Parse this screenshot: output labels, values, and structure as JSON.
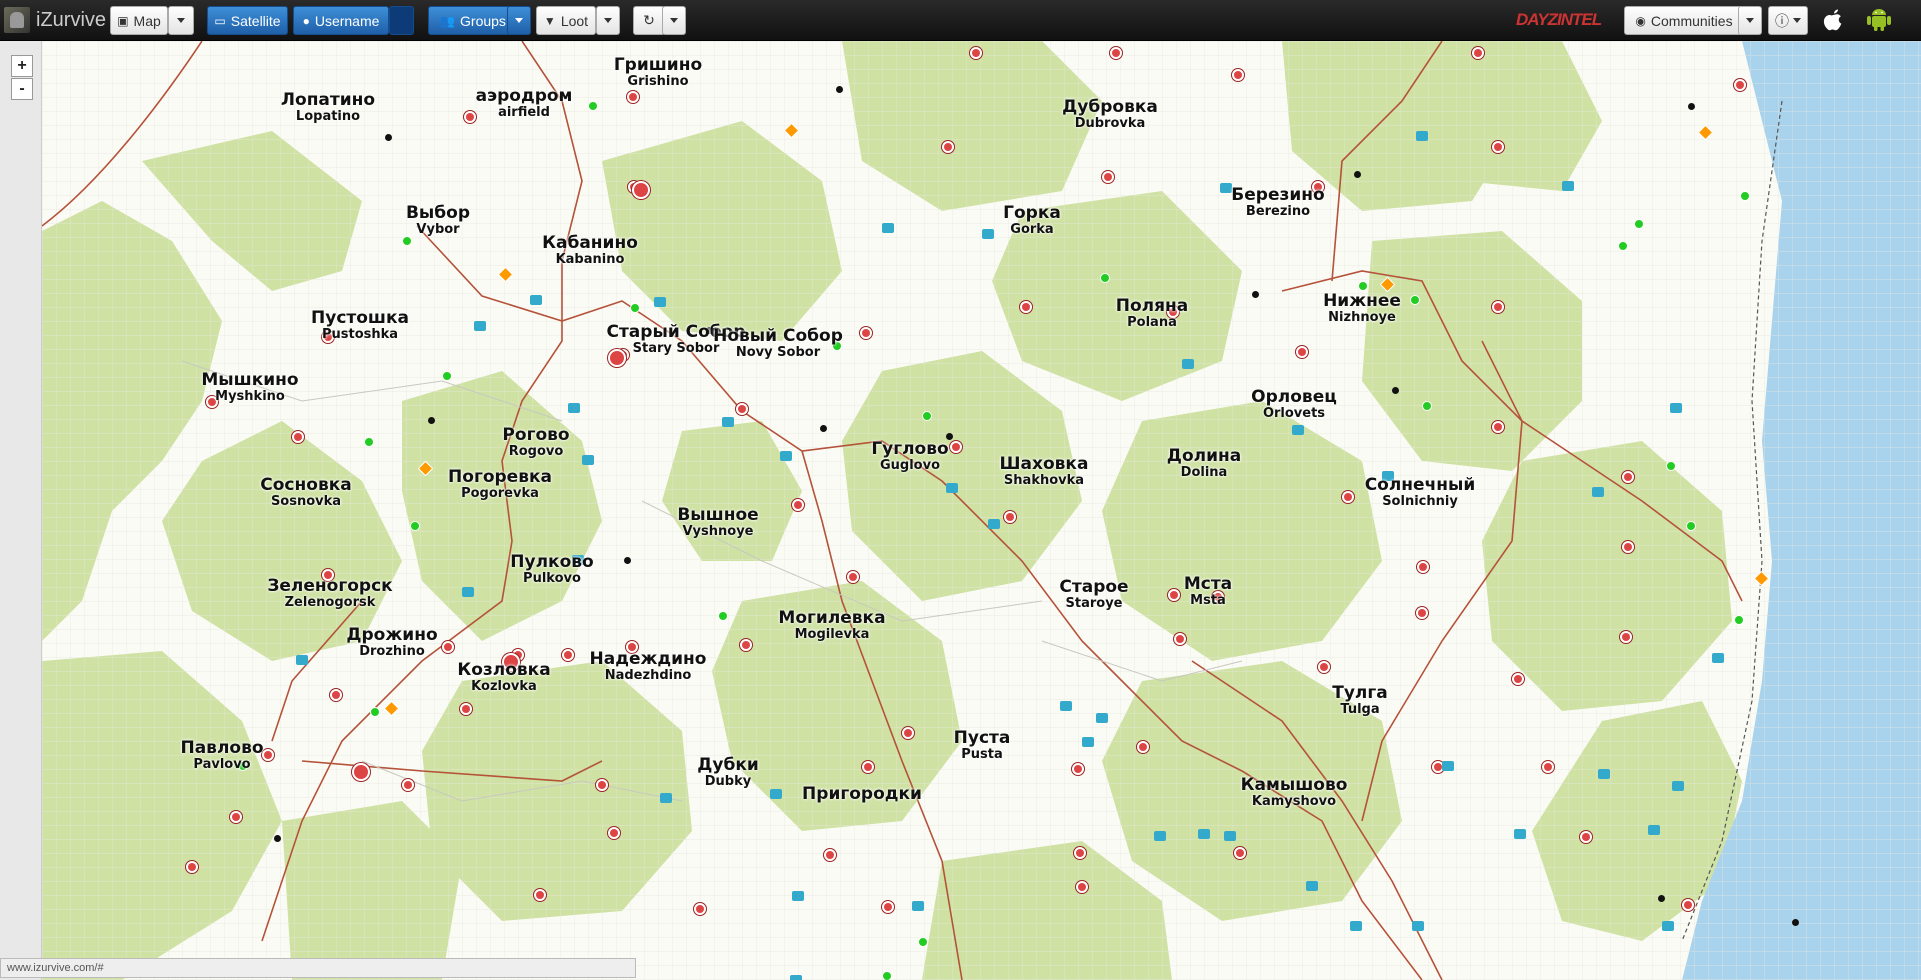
{
  "toolbar": {
    "brand": "iZurvive",
    "map_label": "Map",
    "satellite_label": "Satellite",
    "username_label": "Username",
    "groups_label": "Groups",
    "loot_label": "Loot",
    "communities_label": "Communities",
    "partner_logo": "DAYZINTEL"
  },
  "zoom": {
    "in": "+",
    "out": "-"
  },
  "status_url": "www.izurvive.com/#",
  "cities": [
    {
      "ru": "Лопатино",
      "en": "Lopatino"
    },
    {
      "ru": "аэродром",
      "en": "airfield"
    },
    {
      "ru": "Гришино",
      "en": "Grishino"
    },
    {
      "ru": "Дубровка",
      "en": "Dubrovka"
    },
    {
      "ru": "Выбор",
      "en": "Vybor"
    },
    {
      "ru": "Кабанино",
      "en": "Kabanino"
    },
    {
      "ru": "Горка",
      "en": "Gorka"
    },
    {
      "ru": "Березино",
      "en": "Berezino"
    },
    {
      "ru": "Пустошка",
      "en": "Pustoshka"
    },
    {
      "ru": "Старый Собор",
      "en": "Stary Sobor"
    },
    {
      "ru": "Новый Собор",
      "en": "Novy Sobor"
    },
    {
      "ru": "Поляна",
      "en": "Polana"
    },
    {
      "ru": "Нижнее",
      "en": "Nizhnoye"
    },
    {
      "ru": "Мышкино",
      "en": "Myshkino"
    },
    {
      "ru": "Орловец",
      "en": "Orlovets"
    },
    {
      "ru": "Рогово",
      "en": "Rogovo"
    },
    {
      "ru": "Гуглово",
      "en": "Guglovo"
    },
    {
      "ru": "Шаховка",
      "en": "Shakhovka"
    },
    {
      "ru": "Долина",
      "en": "Dolina"
    },
    {
      "ru": "Сосновка",
      "en": "Sosnovka"
    },
    {
      "ru": "Погоревка",
      "en": "Pogorevka"
    },
    {
      "ru": "Солнечный",
      "en": "Solnichniy"
    },
    {
      "ru": "Вышное",
      "en": "Vyshnoye"
    },
    {
      "ru": "Пулково",
      "en": "Pulkovo"
    },
    {
      "ru": "Зеленогорск",
      "en": "Zelenogorsk"
    },
    {
      "ru": "Старое",
      "en": "Staroye"
    },
    {
      "ru": "Мста",
      "en": "Msta"
    },
    {
      "ru": "Могилевка",
      "en": "Mogilevka"
    },
    {
      "ru": "Дрожино",
      "en": "Drozhino"
    },
    {
      "ru": "Козловка",
      "en": "Kozlovka"
    },
    {
      "ru": "Надеждино",
      "en": "Nadezhdino"
    },
    {
      "ru": "Тулга",
      "en": "Tulga"
    },
    {
      "ru": "Пуста",
      "en": "Pusta"
    },
    {
      "ru": "Павлово",
      "en": "Pavlovo"
    },
    {
      "ru": "Дубки",
      "en": "Dubky"
    },
    {
      "ru": "Камышово",
      "en": "Kamyshovo"
    },
    {
      "ru": "Пригородки",
      "en": ""
    }
  ],
  "colors": {
    "forest": "#cfe2a3",
    "sea": "#a9d3ec",
    "road": "#b5523a",
    "loot_red": "#d44",
    "toolbar_blue": "#2b72c0"
  }
}
